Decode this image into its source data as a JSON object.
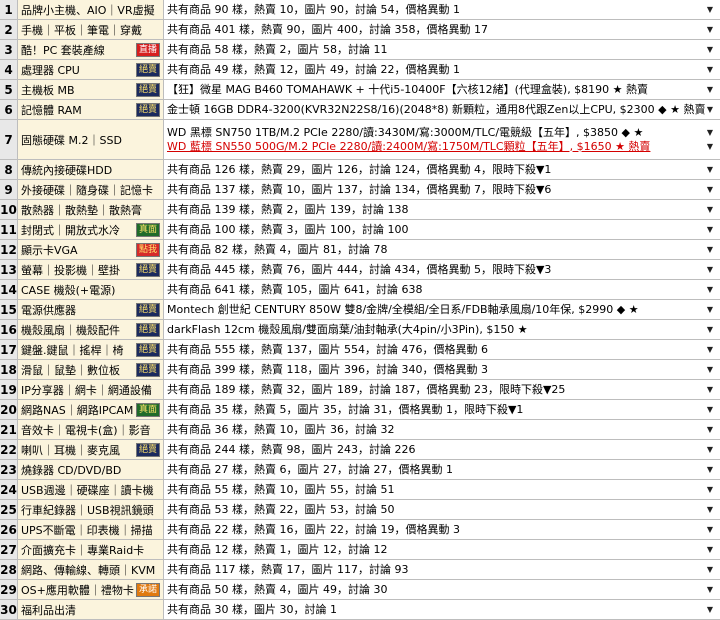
{
  "rows": [
    {
      "num": "1",
      "label": "品牌小主機、AIO｜VR虛擬",
      "lines": [
        "共有商品 90 樣，熱賣 10，圖片 90，討論 54，價格異動 1"
      ]
    },
    {
      "num": "2",
      "label": "手機｜平板｜筆電｜穿戴",
      "lines": [
        "共有商品 401 樣，熱賣 90，圖片 400，討論 358，價格異動 17"
      ]
    },
    {
      "num": "3",
      "label": "酷！PC 套裝產線",
      "badge": "直播",
      "badge_style": "red",
      "lines": [
        "共有商品 58 樣，熱賣 2，圖片 58，討論 11"
      ]
    },
    {
      "num": "4",
      "label": "處理器 CPU",
      "badge": "絕賣",
      "badge_style": "dark",
      "lines": [
        "共有商品 49 樣，熱賣 12，圖片 49，討論 22，價格異動 1"
      ]
    },
    {
      "num": "5",
      "label": "主機板 MB",
      "badge": "絕賣",
      "badge_style": "dark",
      "lines": [
        "【狂】微星 MAG B460 TOMAHAWK + 十代i5-10400F【六核12緒】(代理盒裝), $8190 ★ 熱賣"
      ]
    },
    {
      "num": "6",
      "label": "記憶體 RAM",
      "badge": "絕賣",
      "badge_style": "dark",
      "lines": [
        "金士頓 16GB DDR4-3200(KVR32N22S8/16)(2048*8) 新顆粒，通用8代跟Zen以上CPU, $2300 ◆ ★ 熱賣"
      ]
    },
    {
      "num": "7",
      "label": "固態硬碟 M.2｜SSD",
      "lines": [
        "WD 黑標 SN750 1TB/M.2 PCIe 2280/讀:3430M/寫:3000M/TLC/電競級【五年】, $3850 ◆ ★",
        "WD 藍標 SN550 500G/M.2 PCIe 2280/讀:2400M/寫:1750M/TLC顆粒【五年】, $1650 ★ 熱賣"
      ],
      "red_line": 1
    },
    {
      "num": "8",
      "label": "傳統內接硬碟HDD",
      "lines": [
        "共有商品 126 樣，熱賣 29，圖片 126，討論 124，價格異動 4，限時下殺▼1"
      ]
    },
    {
      "num": "9",
      "label": "外接硬碟｜隨身碟｜記憶卡",
      "lines": [
        "共有商品 137 樣，熱賣 10，圖片 137，討論 134，價格異動 7，限時下殺▼6"
      ]
    },
    {
      "num": "10",
      "label": "散熱器｜散熱墊｜散熱膏",
      "lines": [
        "共有商品 139 樣，熱賣 2，圖片 139，討論 138"
      ]
    },
    {
      "num": "11",
      "label": "封閉式｜開放式水冷",
      "badge": "真面",
      "badge_style": "green",
      "lines": [
        "共有商品 100 樣，熱賣 3，圖片 100，討論 100"
      ]
    },
    {
      "num": "12",
      "label": "顯示卡VGA",
      "badge": "點我",
      "badge_style": "pinkred",
      "lines": [
        "共有商品 82 樣，熱賣 4，圖片 81，討論 78"
      ]
    },
    {
      "num": "13",
      "label": "螢幕｜投影機｜壁掛",
      "badge": "絕賣",
      "badge_style": "dark",
      "lines": [
        "共有商品 445 樣，熱賣 76，圖片 444，討論 434，價格異動 5，限時下殺▼3"
      ]
    },
    {
      "num": "14",
      "label": "CASE 機殼(+電源)",
      "lines": [
        "共有商品 641 樣，熱賣 105，圖片 641，討論 638"
      ]
    },
    {
      "num": "15",
      "label": "電源供應器",
      "badge": "絕賣",
      "badge_style": "dark",
      "lines": [
        "Montech 創世紀 CENTURY 850W 雙8/金牌/全模組/全日系/FDB軸承風扇/10年保, $2990 ◆ ★"
      ]
    },
    {
      "num": "16",
      "label": "機殼風扇｜機殼配件",
      "badge": "絕賣",
      "badge_style": "dark",
      "lines": [
        "darkFlash 12cm 機殼風扇/雙面扇葉/油封軸承(大4pin/小3Pin), $150 ★"
      ]
    },
    {
      "num": "17",
      "label": "鍵盤.鍵鼠｜搖桿｜椅",
      "badge": "絕賣",
      "badge_style": "dark",
      "lines": [
        "共有商品 555 樣，熱賣 137，圖片 554，討論 476，價格異動 6"
      ]
    },
    {
      "num": "18",
      "label": "滑鼠｜鼠墊｜數位板",
      "badge": "絕賣",
      "badge_style": "dark",
      "lines": [
        "共有商品 399 樣，熱賣 118，圖片 396，討論 340，價格異動 3"
      ]
    },
    {
      "num": "19",
      "label": "IP分享器｜網卡｜網通設備",
      "lines": [
        "共有商品 189 樣，熱賣 32，圖片 189，討論 187，價格異動 23，限時下殺▼25"
      ]
    },
    {
      "num": "20",
      "label": "網路NAS｜網路IPCAM",
      "badge": "真面",
      "badge_style": "green",
      "lines": [
        "共有商品 35 樣，熱賣 5，圖片 35，討論 31，價格異動 1，限時下殺▼1"
      ]
    },
    {
      "num": "21",
      "label": "音效卡｜電視卡(盒)｜影音",
      "lines": [
        "共有商品 36 樣，熱賣 10，圖片 36，討論 32"
      ]
    },
    {
      "num": "22",
      "label": "喇叭｜耳機｜麥克風",
      "badge": "絕賣",
      "badge_style": "dark",
      "lines": [
        "共有商品 244 樣，熱賣 98，圖片 243，討論 226"
      ]
    },
    {
      "num": "23",
      "label": "燒錄器 CD/DVD/BD",
      "lines": [
        "共有商品 27 樣，熱賣 6，圖片 27，討論 27，價格異動 1"
      ]
    },
    {
      "num": "24",
      "label": "USB週邊｜硬碟座｜讀卡機",
      "lines": [
        "共有商品 55 樣，熱賣 10，圖片 55，討論 51"
      ]
    },
    {
      "num": "25",
      "label": "行車紀錄器｜USB視訊鏡頭",
      "lines": [
        "共有商品 53 樣，熱賣 22，圖片 53，討論 50"
      ]
    },
    {
      "num": "26",
      "label": "UPS不斷電｜印表機｜掃描",
      "lines": [
        "共有商品 22 樣，熱賣 16，圖片 22，討論 19，價格異動 3"
      ]
    },
    {
      "num": "27",
      "label": "介面擴充卡｜專業Raid卡",
      "lines": [
        "共有商品 12 樣，熱賣 1，圖片 12，討論 12"
      ]
    },
    {
      "num": "28",
      "label": "網路、傳輸線、轉頭｜KVM",
      "lines": [
        "共有商品 117 樣，熱賣 17，圖片 117，討論 93"
      ]
    },
    {
      "num": "29",
      "label": "OS+應用軟體｜禮物卡",
      "badge": "承諾",
      "badge_style": "orange",
      "lines": [
        "共有商品 50 樣，熱賣 4，圖片 49，討論 30"
      ]
    },
    {
      "num": "30",
      "label": "福利品出清",
      "lines": [
        "共有商品 30 樣，圖片 30，討論 1"
      ]
    }
  ],
  "dropdown_arrow": "▼"
}
